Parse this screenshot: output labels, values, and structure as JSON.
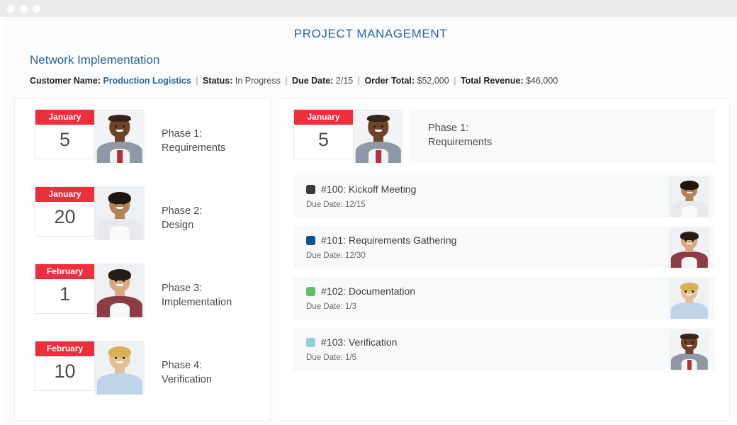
{
  "window": {
    "dots": [
      "close-dot",
      "minimize-dot",
      "maximize-dot"
    ]
  },
  "header": {
    "app_title": "PROJECT MANAGEMENT",
    "project_title": "Network Implementation",
    "meta": {
      "customer_label": "Customer Name:",
      "customer_value": "Production Logistics",
      "status_label": "Status:",
      "status_value": "In Progress",
      "due_label": "Due Date:",
      "due_value": "2/15",
      "order_label": "Order Total:",
      "order_value": "$52,000",
      "revenue_label": "Total Revenue:",
      "revenue_value": "$46,000",
      "separator": "|"
    }
  },
  "colors": {
    "accent_blue": "#2e6496",
    "calendar_red": "#ed2e3d",
    "panel_bg": "#ffffff",
    "row_bg": "#f8f9fa",
    "page_bg": "#fafbfc"
  },
  "phases": [
    {
      "month": "January",
      "day": "5",
      "title_line1": "Phase 1:",
      "title_line2": "Requirements"
    },
    {
      "month": "January",
      "day": "20",
      "title_line1": "Phase 2:",
      "title_line2": "Design"
    },
    {
      "month": "February",
      "day": "1",
      "title_line1": "Phase 3:",
      "title_line2": "Implementation"
    },
    {
      "month": "February",
      "day": "10",
      "title_line1": "Phase 4:",
      "title_line2": "Verification"
    }
  ],
  "detail": {
    "month": "January",
    "day": "5",
    "title_line1": "Phase 1:",
    "title_line2": "Requirements",
    "due_prefix": "Due Date:",
    "tasks": [
      {
        "swatch_color": "#3a3a3a",
        "title": "#100: Kickoff Meeting",
        "due_label": "Due Date: 12/15"
      },
      {
        "swatch_color": "#11518c",
        "title": "#101: Requirements Gathering",
        "due_label": "Due Date: 12/30"
      },
      {
        "swatch_color": "#5fc260",
        "title": "#102: Documentation",
        "due_label": "Due Date: 1/3"
      },
      {
        "swatch_color": "#8fd3d8",
        "title": "#103: Verification",
        "due_label": "Due Date: 1/5"
      }
    ]
  }
}
